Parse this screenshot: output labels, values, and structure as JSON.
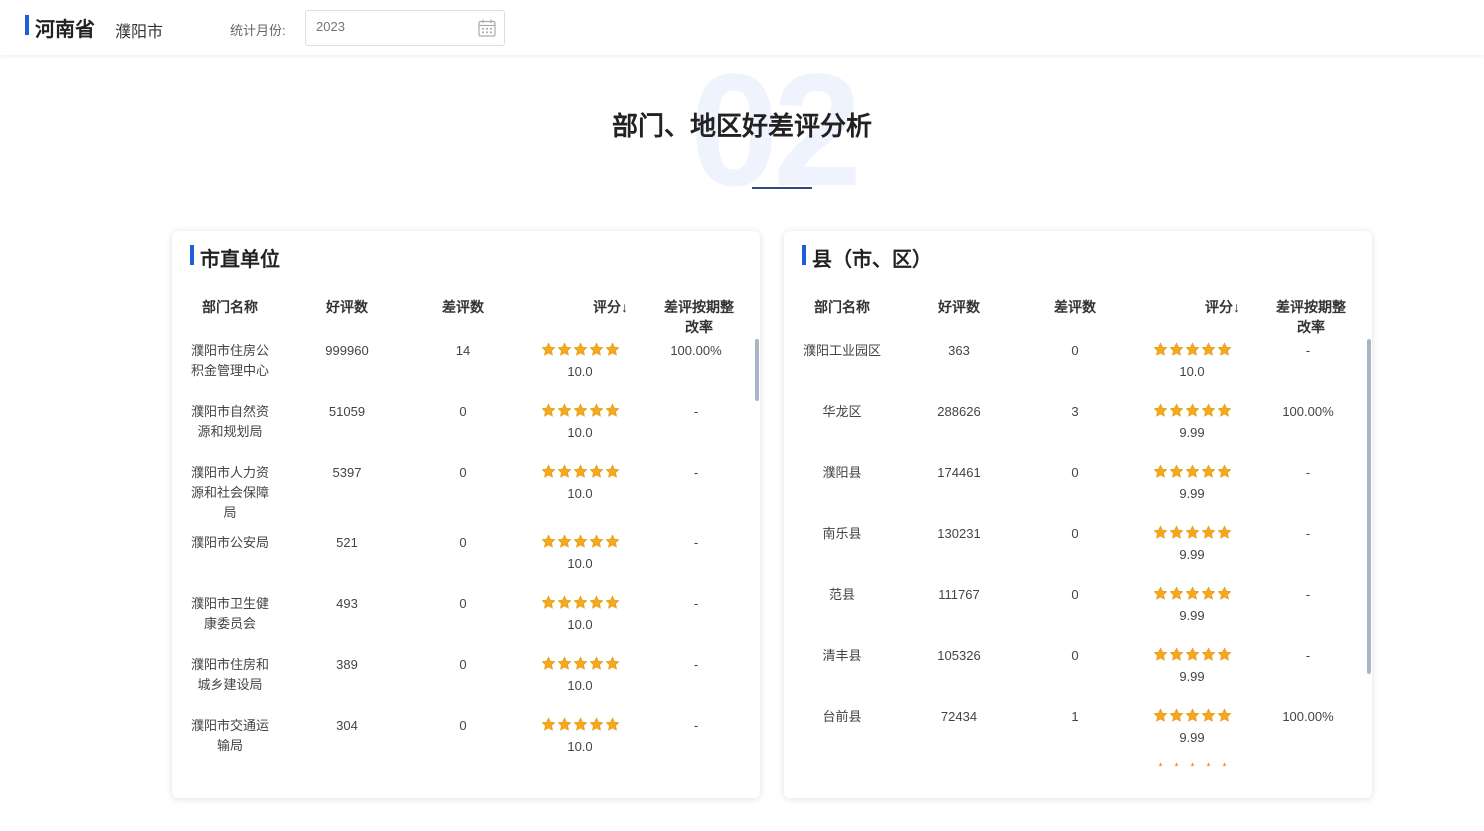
{
  "header": {
    "province": "河南省",
    "city": "濮阳市",
    "month_label": "统计月份:",
    "month_placeholder": "2023"
  },
  "section": {
    "number": "02",
    "title": "部门、地区好差评分析"
  },
  "colors": {
    "accent": "#1d5fd6",
    "star": "#f5a81e",
    "bignum": "#eef3fd"
  },
  "left_card": {
    "title": "市直单位",
    "columns": [
      "部门名称",
      "好评数",
      "差评数",
      "评分↓",
      "差评按期整改率"
    ],
    "rows": [
      {
        "name": "濮阳市住房公积金管理中心",
        "good": "999960",
        "bad": "14",
        "stars": 5,
        "score": "10.0",
        "rate": "100.00%"
      },
      {
        "name": "濮阳市自然资源和规划局",
        "good": "51059",
        "bad": "0",
        "stars": 5,
        "score": "10.0",
        "rate": "-"
      },
      {
        "name": "濮阳市人力资源和社会保障局",
        "good": "5397",
        "bad": "0",
        "stars": 5,
        "score": "10.0",
        "rate": "-"
      },
      {
        "name": "濮阳市公安局",
        "good": "521",
        "bad": "0",
        "stars": 5,
        "score": "10.0",
        "rate": "-"
      },
      {
        "name": "濮阳市卫生健康委员会",
        "good": "493",
        "bad": "0",
        "stars": 5,
        "score": "10.0",
        "rate": "-"
      },
      {
        "name": "濮阳市住房和城乡建设局",
        "good": "389",
        "bad": "0",
        "stars": 5,
        "score": "10.0",
        "rate": "-"
      },
      {
        "name": "濮阳市交通运输局",
        "good": "304",
        "bad": "0",
        "stars": 5,
        "score": "10.0",
        "rate": "-"
      }
    ]
  },
  "right_card": {
    "title": "县（市、区）",
    "columns": [
      "部门名称",
      "好评数",
      "差评数",
      "评分↓",
      "差评按期整改率"
    ],
    "rows": [
      {
        "name": "濮阳工业园区",
        "good": "363",
        "bad": "0",
        "stars": 5,
        "score": "10.0",
        "rate": "-"
      },
      {
        "name": "华龙区",
        "good": "288626",
        "bad": "3",
        "stars": 5,
        "score": "9.99",
        "rate": "100.00%"
      },
      {
        "name": "濮阳县",
        "good": "174461",
        "bad": "0",
        "stars": 5,
        "score": "9.99",
        "rate": "-"
      },
      {
        "name": "南乐县",
        "good": "130231",
        "bad": "0",
        "stars": 5,
        "score": "9.99",
        "rate": "-"
      },
      {
        "name": "范县",
        "good": "111767",
        "bad": "0",
        "stars": 5,
        "score": "9.99",
        "rate": "-"
      },
      {
        "name": "清丰县",
        "good": "105326",
        "bad": "0",
        "stars": 5,
        "score": "9.99",
        "rate": "-"
      },
      {
        "name": "台前县",
        "good": "72434",
        "bad": "1",
        "stars": 5,
        "score": "9.99",
        "rate": "100.00%"
      }
    ]
  }
}
